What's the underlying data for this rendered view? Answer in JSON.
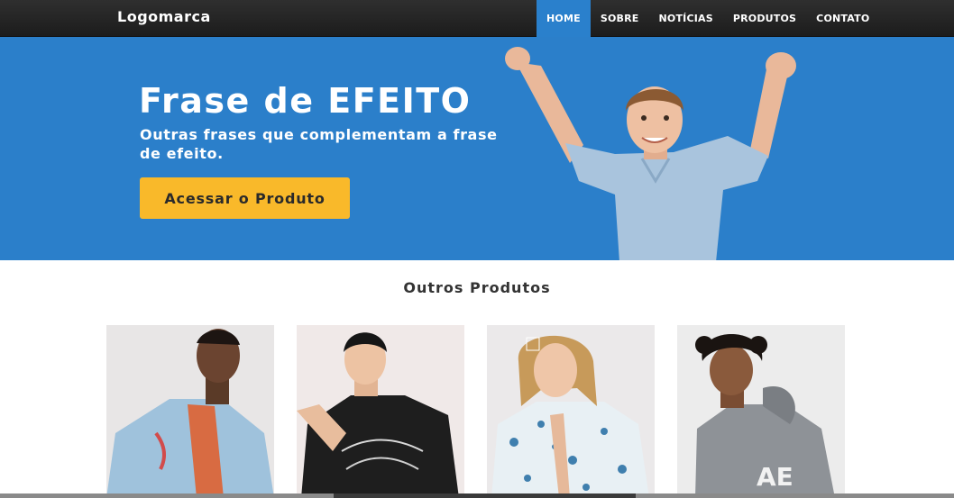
{
  "navbar": {
    "logo": "Logomarca",
    "items": [
      {
        "label": "HOME",
        "active": true
      },
      {
        "label": "SOBRE",
        "active": false
      },
      {
        "label": "NOTÍCIAS",
        "active": false
      },
      {
        "label": "PRODUTOS",
        "active": false
      },
      {
        "label": "CONTATO",
        "active": false
      }
    ]
  },
  "hero": {
    "title": "Frase de EFEITO",
    "subtitle": "Outras frases que complementam a frase de efeito.",
    "button_label": "Acessar o Produto"
  },
  "section": {
    "title": "Outros Produtos"
  },
  "products": [
    {
      "name": "bomber jacket"
    },
    {
      "name": "black t-shirt"
    },
    {
      "name": "printed shirt"
    },
    {
      "name": "grey hoodie",
      "print": "AE"
    }
  ],
  "colors": {
    "navbar": "#252525",
    "nav_active": "#2a80cc",
    "hero_bg": "#2b7fca",
    "button": "#f9b92a"
  }
}
